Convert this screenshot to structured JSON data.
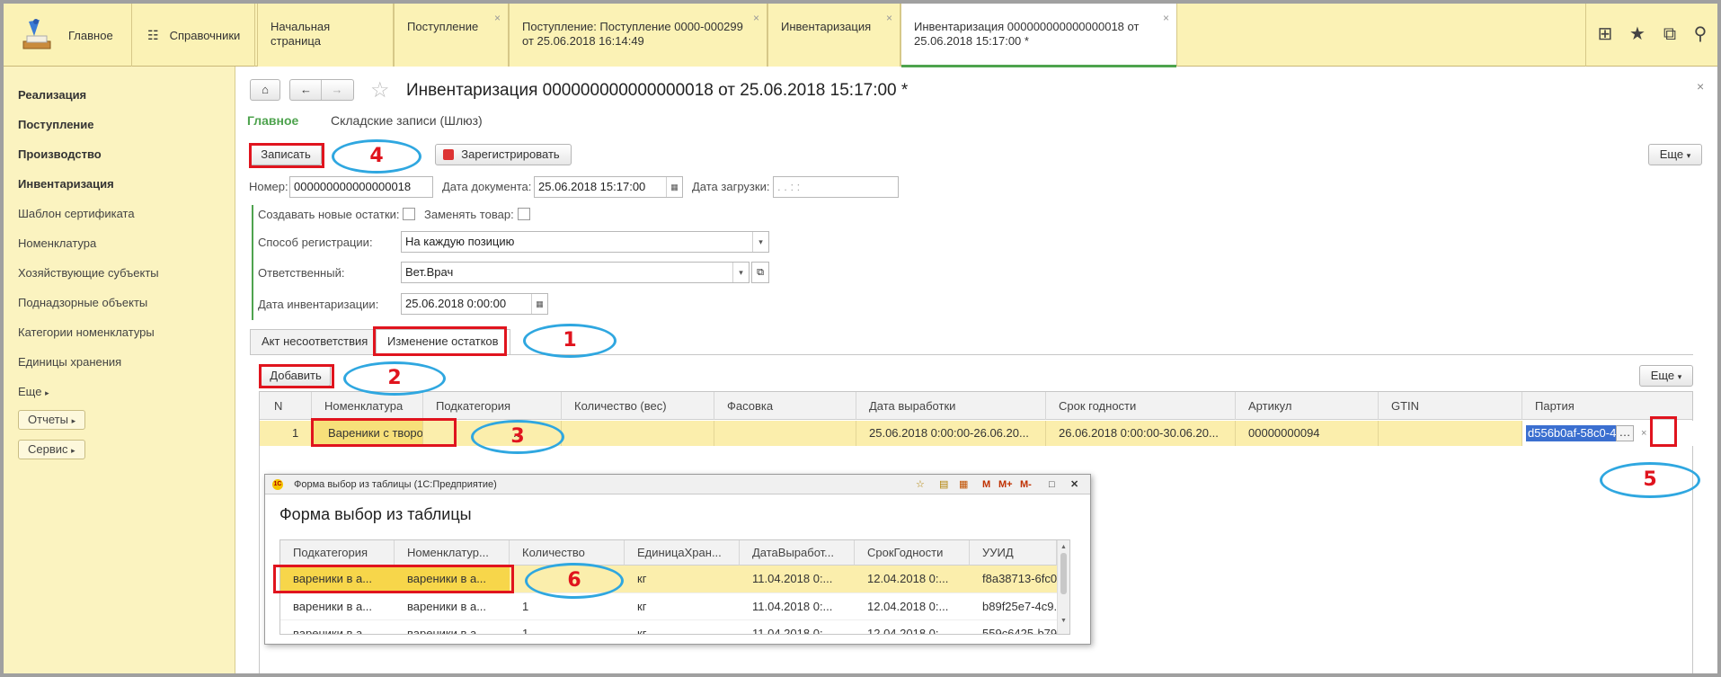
{
  "topbar": {
    "sections": [
      {
        "label": "Главное",
        "icon": "desk-lamp-icon"
      },
      {
        "label": "Справочники",
        "icon": "list-icon"
      }
    ],
    "tabs": [
      {
        "label": "Начальная страница"
      },
      {
        "label": "Поступление"
      },
      {
        "label": "Поступление: Поступление 0000-000299 от 25.06.2018 16:14:49"
      },
      {
        "label": "Инвентаризация"
      },
      {
        "label": "Инвентаризация 000000000000000018 от 25.06.2018 15:17:00 *"
      }
    ],
    "close_glyph": "×",
    "right_icons": [
      "grid-icon",
      "star-icon",
      "history-icon",
      "search-icon"
    ]
  },
  "sidebar": {
    "items": [
      {
        "label": "Реализация",
        "bold": true
      },
      {
        "label": "Поступление",
        "bold": true
      },
      {
        "label": "Производство",
        "bold": true
      },
      {
        "label": "Инвентаризация",
        "bold": true
      },
      {
        "label": "Шаблон сертификата"
      },
      {
        "label": "Номенклатура"
      },
      {
        "label": "Хозяйствующие субъекты"
      },
      {
        "label": "Поднадзорные объекты"
      },
      {
        "label": "Категории номенклатуры"
      },
      {
        "label": "Единицы хранения"
      },
      {
        "label": "Еще"
      }
    ],
    "buttons": [
      "Отчеты",
      "Сервис"
    ]
  },
  "form": {
    "title": "Инвентаризация 000000000000000018 от 25.06.2018 15:17:00 *",
    "sections": [
      "Главное",
      "Складские записи (Шлюз)"
    ],
    "buttons": {
      "save": "Записать",
      "register": "Зарегистрировать",
      "more": "Еще"
    },
    "fields": {
      "number_label": "Номер:",
      "number_value": "000000000000000018",
      "docdate_label": "Дата документа:",
      "docdate_value": "25.06.2018 15:17:00",
      "loaddate_label": "Дата загрузки:",
      "loaddate_value": " .  .       :  :",
      "create_new_label": "Создавать новые остатки:",
      "replace_label": "Заменять товар:",
      "regmethod_label": "Способ регистрации:",
      "regmethod_value": "На каждую позицию",
      "responsible_label": "Ответственный:",
      "responsible_value": "Вет.Врач",
      "invdate_label": "Дата инвентаризации:",
      "invdate_value": "25.06.2018  0:00:00"
    },
    "tabs": [
      "Акт несоответствия",
      "Изменение остатков"
    ],
    "table": {
      "add_label": "Добавить",
      "more_label": "Еще",
      "columns": [
        "N",
        "Номенклатура",
        "Подкатегория",
        "Количество (вес)",
        "Фасовка",
        "Дата выработки",
        "Срок годности",
        "Артикул",
        "GTIN",
        "Партия"
      ],
      "rows": [
        {
          "n": "1",
          "nomenclature": "Вареники с творог",
          "subcategory": "...",
          "qty": "",
          "packing": "",
          "prod_date": "25.06.2018 0:00:00-26.06.20...",
          "expiry": "26.06.2018 0:00:00-30.06.20...",
          "article": "00000000094",
          "gtin": "",
          "batch": "d556b0af-58c0-4"
        }
      ]
    }
  },
  "popup": {
    "window_title": "Форма выбор из таблицы  (1С:Предприятие)",
    "title": "Форма выбор из таблицы",
    "toolbar_glyphs": [
      "M",
      "M+",
      "M-"
    ],
    "columns": [
      "Подкатегория",
      "Номенклатур...",
      "Количество",
      "ЕдиницаХран...",
      "ДатаВыработ...",
      "СрокГодности",
      "УУИД"
    ],
    "rows": [
      [
        "вареники в а...",
        "вареники в а...",
        "",
        "кг",
        "11.04.2018 0:...",
        "12.04.2018 0:...",
        "f8a38713-6fc0"
      ],
      [
        "вареники в а...",
        "вареники в а...",
        "1",
        "кг",
        "11.04.2018 0:...",
        "12.04.2018 0:...",
        "b89f25e7-4c9."
      ],
      [
        "вареники в а...",
        "вареники в а...",
        "1",
        "кг",
        "11.04.2018 0:...",
        "12.04.2018 0:...",
        "559c6425-b79"
      ]
    ]
  },
  "annotations": [
    "1",
    "2",
    "3",
    "4",
    "5",
    "6"
  ],
  "colors": {
    "accent_yellow": "#fbf2b5",
    "highlight_row": "#fbeeac",
    "annotation_red": "#e0141e",
    "annotation_blue": "#2fa7e0",
    "section_green": "#4ea34e"
  }
}
